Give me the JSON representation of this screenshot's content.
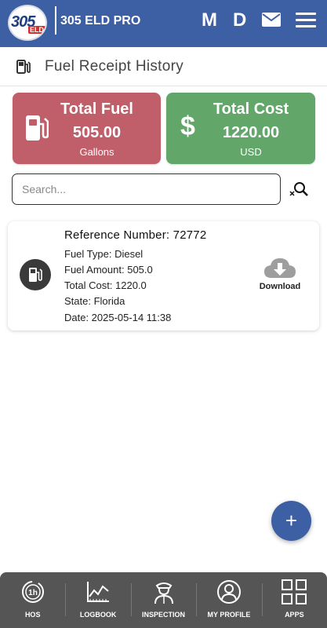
{
  "header": {
    "logo_text": "305",
    "logo_badge": "ELD",
    "app_title": "305 ELD PRO",
    "letter_m": "M",
    "letter_d": "D",
    "icons": [
      "mail-icon",
      "menu-icon"
    ]
  },
  "page": {
    "title": "Fuel Receipt History",
    "icon": "fuel-pump-icon"
  },
  "summary": {
    "fuel": {
      "title": "Total Fuel",
      "value": "505.00",
      "unit": "Gallons",
      "color": "#c05e6a"
    },
    "cost": {
      "title": "Total Cost",
      "value": "1220.00",
      "unit": "USD",
      "color": "#62a66a"
    }
  },
  "search": {
    "placeholder": "Search...",
    "value": ""
  },
  "receipts": [
    {
      "reference": "Reference Number: 72772",
      "fuel_type": "Fuel Type: Diesel",
      "fuel_amount": "Fuel Amount: 505.0",
      "total_cost": "Total Cost: 1220.0",
      "state": "State: Florida",
      "date": "Date: 2025-05-14 11:38",
      "download_label": "Download"
    }
  ],
  "fab": {
    "label": "+"
  },
  "bottom_nav": [
    {
      "label": "HOS",
      "icon": "clock-1h-icon"
    },
    {
      "label": "LOGBOOK",
      "icon": "chart-icon"
    },
    {
      "label": "INSPECTION",
      "icon": "inspector-icon"
    },
    {
      "label": "MY PROFILE",
      "icon": "profile-icon"
    },
    {
      "label": "APPS",
      "icon": "apps-grid-icon"
    }
  ],
  "colors": {
    "primary": "#3d5fa3",
    "nav_background": "#555555"
  }
}
